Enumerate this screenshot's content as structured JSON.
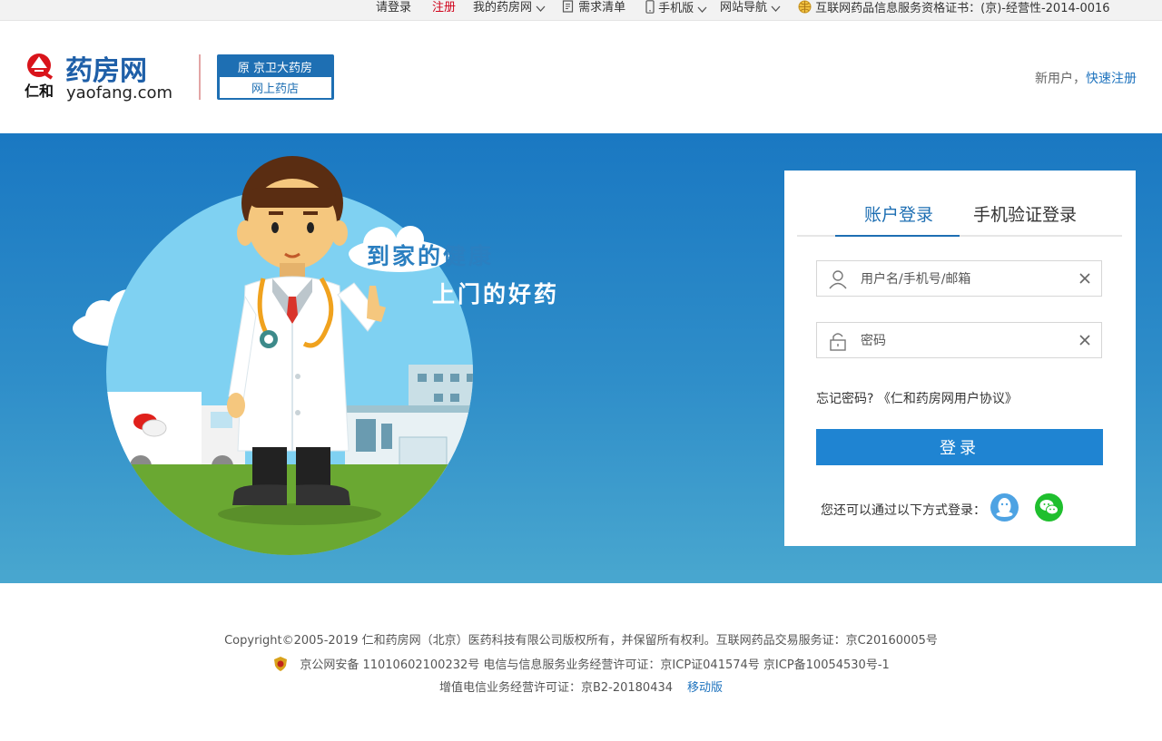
{
  "topbar": {
    "login": "请登录",
    "register": "注册",
    "my_yaofang": "我的药房网",
    "demand_list": "需求清单",
    "mobile": "手机版",
    "site_nav": "网站导航",
    "certificate": "互联网药品信息服务资格证书：(京)-经营性-2014-0016"
  },
  "header": {
    "logo_cn": "药房网",
    "logo_renhe": "仁和",
    "logo_domain": "yaofang.com",
    "badge_top": "原 京卫大药房",
    "badge_bottom": "网上药店",
    "new_user": "新用户，",
    "quick_register": "快速注册"
  },
  "banner": {
    "slogan_line1": "到家的健康",
    "slogan_line2": "上门的好药"
  },
  "login": {
    "tab_account": "账户登录",
    "tab_phone": "手机验证登录",
    "username_placeholder": "用户名/手机号/邮箱",
    "password_placeholder": "密码",
    "forgot": "忘记密码?",
    "agreement": "《仁和药房网用户协议》",
    "submit": "登录",
    "other_methods": "您还可以通过以下方式登录："
  },
  "footer": {
    "line1": "Copyright©2005-2019 仁和药房网（北京）医药科技有限公司版权所有，并保留所有权利。互联网药品交易服务证：京C20160005号",
    "line2": "京公网安备 11010602100232号 电信与信息服务业务经营许可证：京ICP证041574号 京ICP备10054530号-1",
    "line3": "增值电信业务经营许可证：京B2-20180434",
    "mobile_link": "移动版"
  },
  "colors": {
    "brand_blue": "#1e73be",
    "button_blue": "#1f84d2",
    "banner_top": "#1a78c2",
    "banner_bottom": "#49a7cf",
    "accent_red": "#d0021b"
  },
  "icons": [
    "chevron-down-icon",
    "list-icon",
    "phone-icon",
    "globe-icon",
    "user-icon",
    "lock-icon",
    "clear-icon",
    "qq-icon",
    "wechat-icon",
    "police-badge-icon"
  ]
}
